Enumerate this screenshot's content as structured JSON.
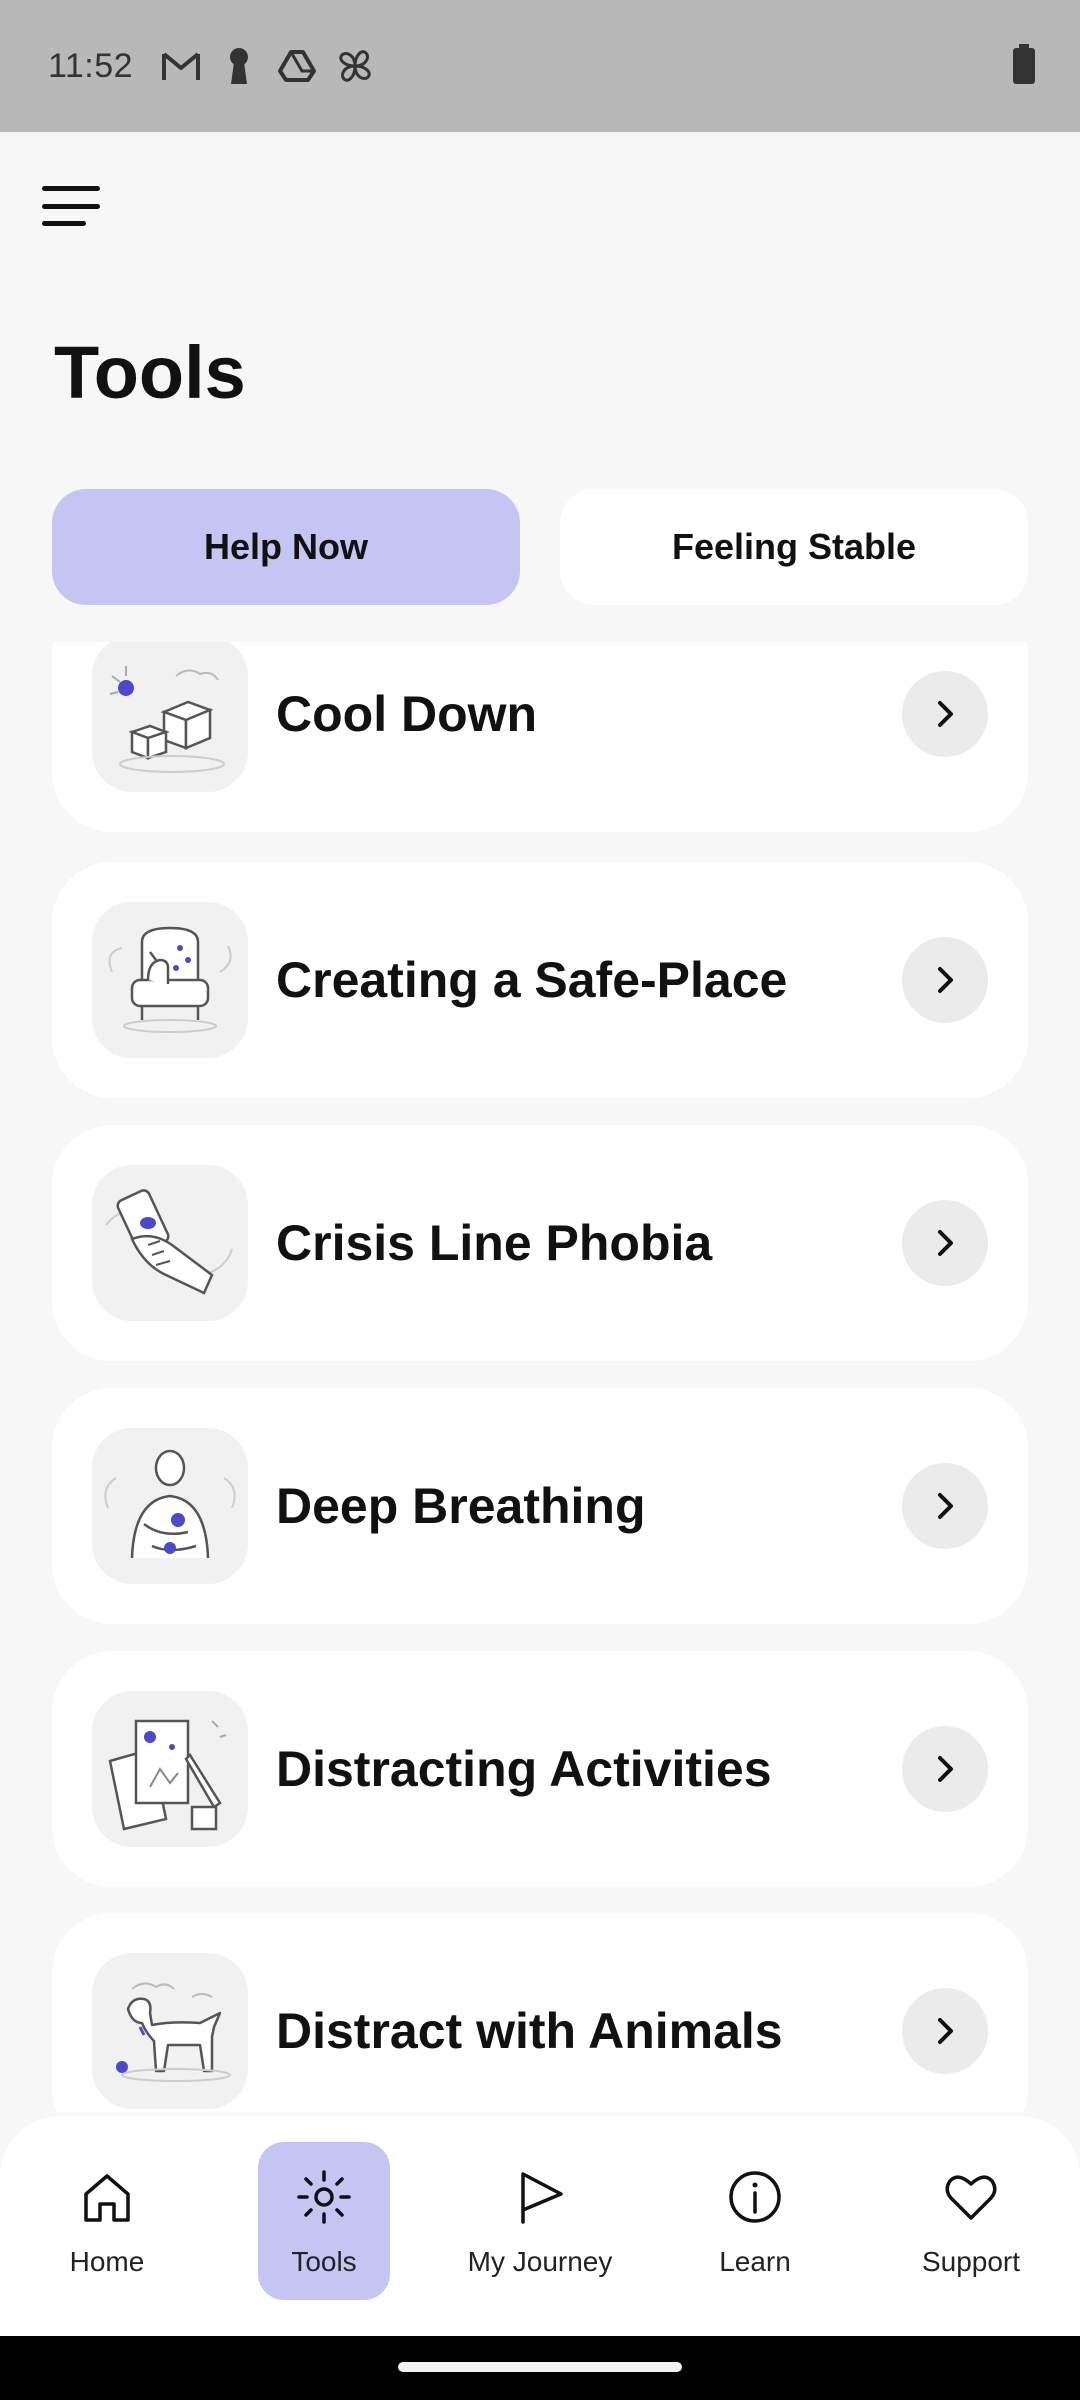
{
  "status_bar": {
    "time": "11:52",
    "icons": [
      "gmail-icon",
      "keyhole-icon",
      "drive-icon",
      "pinwheel-icon"
    ],
    "battery_icon": "battery-icon"
  },
  "header": {
    "menu_icon": "hamburger-menu-icon",
    "title": "Tools"
  },
  "tabs": [
    {
      "label": "Help Now",
      "active": true
    },
    {
      "label": "Feeling Stable",
      "active": false
    }
  ],
  "tools": [
    {
      "title": "Cool Down",
      "illustration": "ice-cubes-illustration"
    },
    {
      "title": "Creating a Safe-Place",
      "illustration": "armchair-dog-illustration"
    },
    {
      "title": "Crisis Line Phobia",
      "illustration": "hand-holding-phone-illustration"
    },
    {
      "title": "Deep Breathing",
      "illustration": "person-breathing-illustration"
    },
    {
      "title": "Distracting Activities",
      "illustration": "paper-pencil-illustration"
    },
    {
      "title": "Distract with Animals",
      "illustration": "dog-illustration"
    }
  ],
  "bottom_nav": [
    {
      "label": "Home",
      "icon": "home-icon",
      "active": false
    },
    {
      "label": "Tools",
      "icon": "sun-icon",
      "active": true
    },
    {
      "label": "My Journey",
      "icon": "flag-icon",
      "active": false
    },
    {
      "label": "Learn",
      "icon": "info-icon",
      "active": false
    },
    {
      "label": "Support",
      "icon": "heart-icon",
      "active": false
    }
  ],
  "colors": {
    "accent": "#c5c5f3",
    "illustration_dot": "#4b4bc9",
    "background": "#f7f7f7",
    "status_bar": "#b8b8b8"
  }
}
